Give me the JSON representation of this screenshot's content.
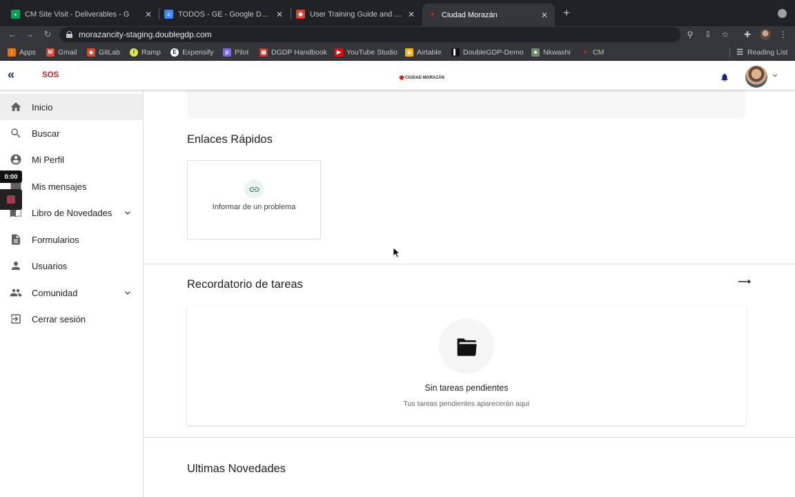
{
  "browser": {
    "tabs": [
      {
        "title": "CM Site Visit - Deliverables - G",
        "favicon": "sheets-icon"
      },
      {
        "title": "TODOS - GE - Google Docs",
        "favicon": "docs-icon"
      },
      {
        "title": "User Training Guide and Conte",
        "favicon": "gitlab-icon"
      },
      {
        "title": "Ciudad Morazán",
        "favicon": "cm-icon"
      }
    ],
    "new_tab": "+",
    "url": "morazancity-staging.doublegdp.com",
    "bookmarks": [
      {
        "label": "Apps",
        "icon": "apps-grid-icon",
        "color": "#e8710a"
      },
      {
        "label": "Gmail",
        "icon": "gmail-icon",
        "color": "#ea4335"
      },
      {
        "label": "GitLab",
        "icon": "gitlab-icon",
        "color": "#e24329"
      },
      {
        "label": "Ramp",
        "icon": "ramp-icon",
        "color": "#e4e44a"
      },
      {
        "label": "Expensify",
        "icon": "expensify-icon",
        "color": "#ffffff"
      },
      {
        "label": "Pilot",
        "icon": "pilot-icon",
        "color": "#7b68ee"
      },
      {
        "label": "DGDP Handbook",
        "icon": "handbook-icon",
        "color": "#c0392b"
      },
      {
        "label": "YouTube Studio",
        "icon": "youtube-icon",
        "color": "#ff0000"
      },
      {
        "label": "Airtable",
        "icon": "airtable-icon",
        "color": "#fcb400"
      },
      {
        "label": "DoubleGDP-Demo",
        "icon": "doublegdp-icon",
        "color": "#111111"
      },
      {
        "label": "Nkwashi",
        "icon": "nkwashi-icon",
        "color": "#6b8e6b"
      },
      {
        "label": "CM",
        "icon": "cm-icon",
        "color": "#c62828"
      }
    ],
    "reading_list": "Reading List"
  },
  "header": {
    "sos": "SOS",
    "brand": "CIUDAD MORAZÁN",
    "accent": "#1a237e"
  },
  "sidebar": {
    "items": [
      {
        "label": "Inicio",
        "icon": "home-icon"
      },
      {
        "label": "Buscar",
        "icon": "search-icon"
      },
      {
        "label": "Mi Perfil",
        "icon": "account-circle-icon"
      },
      {
        "label": "Mis mensajes",
        "icon": "message-icon"
      },
      {
        "label": "Libro de Novedades",
        "icon": "book-icon"
      },
      {
        "label": "Formularios",
        "icon": "form-icon"
      },
      {
        "label": "Usuarios",
        "icon": "person-icon"
      },
      {
        "label": "Comunidad",
        "icon": "people-icon"
      },
      {
        "label": "Cerrar sesión",
        "icon": "logout-icon"
      }
    ]
  },
  "recorder": {
    "timer": "0:00"
  },
  "main": {
    "quick_links": {
      "title": "Enlaces Rápidos",
      "items": [
        {
          "label": "Informar de un problema",
          "icon": "link-icon"
        }
      ]
    },
    "tasks": {
      "title": "Recordatorio de tareas",
      "empty_title": "Sin tareas pendientes",
      "empty_subtitle": "Tus tareas pendientes aparecerán aquí"
    },
    "news": {
      "title": "Ultimas Novedades"
    }
  }
}
